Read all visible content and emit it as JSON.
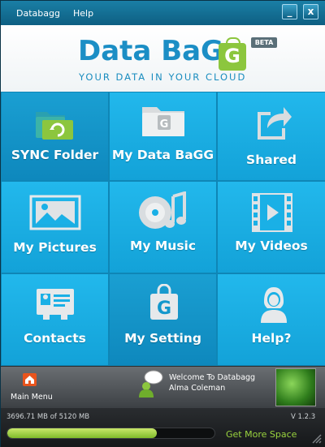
{
  "menu": {
    "databagg": "Databagg",
    "help": "Help"
  },
  "window_controls": {
    "minimize": "_",
    "close": "x"
  },
  "brand": {
    "logo_text": "Data BaG",
    "logo_last_letter": "G",
    "beta_badge": "BETA",
    "tagline": "YOUR DATA IN YOUR CLOUD"
  },
  "tiles": [
    {
      "label": "SYNC Folder",
      "icon": "sync-folder-icon"
    },
    {
      "label": "My Data BaGG",
      "icon": "databagg-folder-icon"
    },
    {
      "label": "Shared",
      "icon": "share-icon"
    },
    {
      "label": "My Pictures",
      "icon": "picture-icon"
    },
    {
      "label": "My Music",
      "icon": "music-icon"
    },
    {
      "label": "My Videos",
      "icon": "video-icon"
    },
    {
      "label": "Contacts",
      "icon": "contacts-icon"
    },
    {
      "label": "My Setting",
      "icon": "databagg-bag-icon"
    },
    {
      "label": "Help?",
      "icon": "help-person-icon"
    }
  ],
  "footer": {
    "main_menu": "Main Menu",
    "welcome": "Welcome To Databagg",
    "user_name": "Alma Coleman"
  },
  "status": {
    "storage_text": "3696.71 MB of 5120 MB",
    "storage_fraction": 0.722,
    "version": "V 1.2.3",
    "get_more_space": "Get More Space"
  },
  "colors": {
    "tile": "#1ab0e6",
    "tile_dark": "#1297cc",
    "brand_blue": "#1b8ec5",
    "brand_green": "#8cc63e",
    "accent_orange": "#e8541d"
  }
}
